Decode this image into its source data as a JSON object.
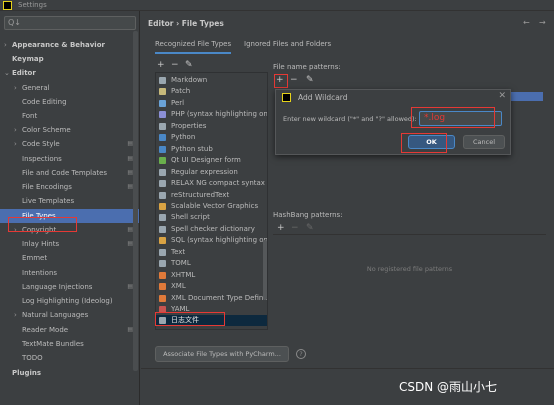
{
  "window": {
    "title": "Settings"
  },
  "search": {
    "glyph": "Q↓"
  },
  "sidebar": {
    "items": [
      {
        "label": "Appearance & Behavior",
        "arrow": "›",
        "bold": true
      },
      {
        "label": "Keymap",
        "bold": true
      },
      {
        "label": "Editor",
        "arrow": "⌄",
        "bold": true
      },
      {
        "label": "General",
        "arrow": "›"
      },
      {
        "label": "Code Editing"
      },
      {
        "label": "Font"
      },
      {
        "label": "Color Scheme",
        "arrow": "›"
      },
      {
        "label": "Code Style",
        "arrow": "›",
        "proj": "▤"
      },
      {
        "label": "Inspections",
        "proj": "▤"
      },
      {
        "label": "File and Code Templates",
        "proj": "▤"
      },
      {
        "label": "File Encodings",
        "proj": "▤"
      },
      {
        "label": "Live Templates"
      },
      {
        "label": "File Types",
        "selected": true
      },
      {
        "label": "Copyright",
        "arrow": "›",
        "proj": "▤"
      },
      {
        "label": "Inlay Hints",
        "proj": "▤"
      },
      {
        "label": "Emmet"
      },
      {
        "label": "Intentions"
      },
      {
        "label": "Language Injections",
        "proj": "▤"
      },
      {
        "label": "Log Highlighting (Ideolog)"
      },
      {
        "label": "Natural Languages",
        "arrow": "›"
      },
      {
        "label": "Reader Mode",
        "proj": "▤"
      },
      {
        "label": "TextMate Bundles"
      },
      {
        "label": "TODO"
      },
      {
        "label": "Plugins",
        "bold": true
      }
    ]
  },
  "header": {
    "breadcrumb": "Editor  ›  File Types",
    "back": "←",
    "forward": "→"
  },
  "tabs": [
    {
      "label": "Recognized File Types",
      "active": true
    },
    {
      "label": "Ignored Files and Folders"
    }
  ],
  "file_types": {
    "toolbar": {
      "add": "+",
      "remove": "−",
      "edit": "✎"
    },
    "items": [
      "Markdown",
      "Patch",
      "Perl",
      "PHP (syntax highlighting only)",
      "Properties",
      "Python",
      "Python stub",
      "Qt UI Designer form",
      "Regular expression",
      "RELAX NG compact syntax",
      "reStructuredText",
      "Scalable Vector Graphics",
      "Shell script",
      "Spell checker dictionary",
      "SQL (syntax highlighting only)",
      "Text",
      "TOML",
      "XHTML",
      "XML",
      "XML Document Type Definitio",
      "YAML",
      "日志文件"
    ],
    "selected_index": 21,
    "associate_button": "Associate File Types with PyCharm...",
    "help": "?"
  },
  "patterns": {
    "label": "File name patterns:",
    "toolbar": {
      "add": "+",
      "remove": "−",
      "edit": "✎"
    },
    "hashbang_label": "HashBang patterns:",
    "hashbang_toolbar": {
      "add": "+",
      "remove": "−",
      "edit": "✎"
    },
    "hashbang_empty": "No registered file patterns"
  },
  "dialog": {
    "title": "Add Wildcard",
    "close": "✕",
    "prompt": "Enter new wildcard (\"*\" and \"?\" allowed):",
    "value": "*.log",
    "ok": "OK",
    "cancel": "Cancel"
  },
  "watermark": "CSDN @雨山小七",
  "colors": {
    "selection": "#4b6eaf",
    "annotation_red": "#e53935",
    "primary_button": "#365880"
  }
}
